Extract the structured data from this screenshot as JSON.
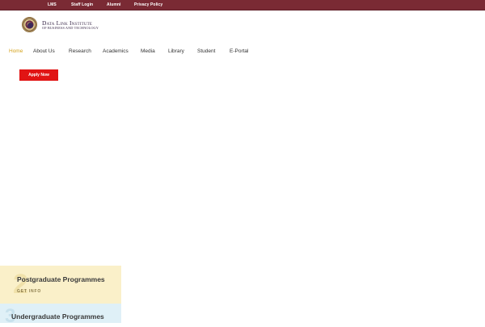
{
  "topbar": {
    "links": [
      "LMS",
      "Staff Login",
      "Alumni",
      "Privacy Policy"
    ],
    "color": "#7a2a34"
  },
  "logo": {
    "title": "Data Link Institute",
    "subtitle": "of Business and Technology"
  },
  "nav": {
    "items": [
      "Home",
      "About Us",
      "Research",
      "Academics",
      "Media",
      "Library",
      "Student",
      "E-Portal"
    ],
    "active": "Home",
    "active_color": "#d4a21a"
  },
  "cta": {
    "apply_label": "Apply Now",
    "color": "#e11414"
  },
  "programmes": [
    {
      "title": "Postgraduate Programmes",
      "link": "GET INFO",
      "bg_color": "#faf0c9"
    },
    {
      "title": "Undergraduate Programmes",
      "bg_color": "#dff0f7"
    }
  ]
}
